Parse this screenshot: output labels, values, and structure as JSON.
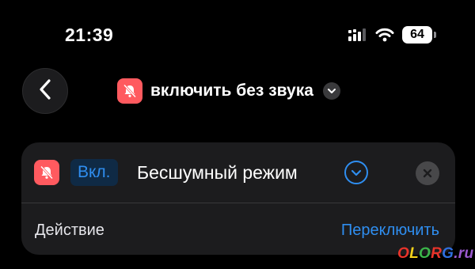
{
  "status_bar": {
    "time": "21:39",
    "battery_level": "64",
    "icons": [
      "cellular-signal-icon",
      "wifi-icon",
      "battery-icon"
    ]
  },
  "nav": {
    "back_icon": "chevron-left-icon",
    "title": "включить без звука",
    "title_icon": "bell-slash-icon",
    "title_chevron": "chevron-down-icon"
  },
  "action": {
    "icon": "bell-slash-icon",
    "state_value": "Вкл.",
    "target": "Бесшумный режим",
    "target_chevron": "chevron-down-circle-icon",
    "clear_icon": "close-circle-icon",
    "parameter_label": "Действие",
    "parameter_value": "Переключить"
  },
  "watermark": {
    "text": "OLORG.ru"
  },
  "colors": {
    "background": "#000000",
    "card": "#1c1c1e",
    "accent": "#2f8ef0",
    "icon_red": "#ff5a5f",
    "pill_bg": "#0f2a45"
  }
}
